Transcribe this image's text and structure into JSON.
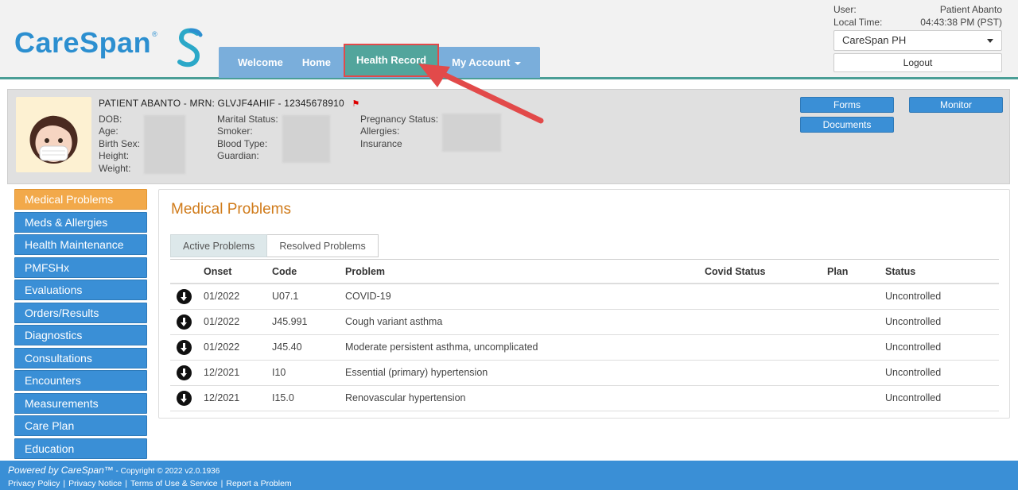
{
  "brand": {
    "name": "CareSpan",
    "reg": "®"
  },
  "nav": {
    "items": [
      {
        "label": "Welcome"
      },
      {
        "label": "Home"
      },
      {
        "label": "Health Record"
      },
      {
        "label": "My Account"
      }
    ]
  },
  "user": {
    "user_label": "User:",
    "user_value": "Patient Abanto",
    "time_label": "Local Time:",
    "time_value": "04:43:38 PM (PST)",
    "org_select": "CareSpan PH",
    "logout": "Logout"
  },
  "patient": {
    "header": "PATIENT ABANTO - MRN: GLVJF4AHIF - 12345678910",
    "col1": [
      "DOB:",
      "Age:",
      "Birth Sex:",
      "Height:",
      "Weight:"
    ],
    "col2": [
      "Marital Status:",
      "Smoker:",
      "Blood Type:",
      "Guardian:"
    ],
    "col3": [
      "Pregnancy Status:",
      "Allergies:",
      "Insurance"
    ],
    "buttons": {
      "forms": "Forms",
      "documents": "Documents",
      "monitor": "Monitor"
    }
  },
  "sidebar": {
    "items": [
      {
        "label": "Medical Problems"
      },
      {
        "label": "Meds & Allergies"
      },
      {
        "label": "Health Maintenance"
      },
      {
        "label": "PMFSHx"
      },
      {
        "label": "Evaluations"
      },
      {
        "label": "Orders/Results"
      },
      {
        "label": "Diagnostics"
      },
      {
        "label": "Consultations"
      },
      {
        "label": "Encounters"
      },
      {
        "label": "Measurements"
      },
      {
        "label": "Care Plan"
      },
      {
        "label": "Education"
      }
    ]
  },
  "main": {
    "title": "Medical Problems",
    "tabs": [
      {
        "label": "Active Problems"
      },
      {
        "label": "Resolved Problems"
      }
    ],
    "columns": {
      "onset": "Onset",
      "code": "Code",
      "problem": "Problem",
      "covid": "Covid Status",
      "plan": "Plan",
      "status": "Status"
    },
    "rows": [
      {
        "onset": "01/2022",
        "code": "U07.1",
        "problem": "COVID-19",
        "covid": "",
        "plan": "",
        "status": "Uncontrolled"
      },
      {
        "onset": "01/2022",
        "code": "J45.991",
        "problem": "Cough variant asthma",
        "covid": "",
        "plan": "",
        "status": "Uncontrolled"
      },
      {
        "onset": "01/2022",
        "code": "J45.40",
        "problem": "Moderate persistent asthma, uncomplicated",
        "covid": "",
        "plan": "",
        "status": "Uncontrolled"
      },
      {
        "onset": "12/2021",
        "code": "I10",
        "problem": "Essential (primary) hypertension",
        "covid": "",
        "plan": "",
        "status": "Uncontrolled"
      },
      {
        "onset": "12/2021",
        "code": "I15.0",
        "problem": "Renovascular hypertension",
        "covid": "",
        "plan": "",
        "status": "Uncontrolled"
      }
    ]
  },
  "footer": {
    "powered": "Powered by CareSpan™",
    "copyright": " - Copyright © 2022 v2.0.1936",
    "links": [
      "Privacy Policy",
      "Privacy Notice",
      "Terms of Use & Service",
      "Report a Problem"
    ]
  },
  "colors": {
    "primary": "#3a8fd6",
    "active_nav": "#52a59c",
    "active_side": "#f2a94a",
    "title": "#d07b1a",
    "annotation": "#e24a4a"
  }
}
